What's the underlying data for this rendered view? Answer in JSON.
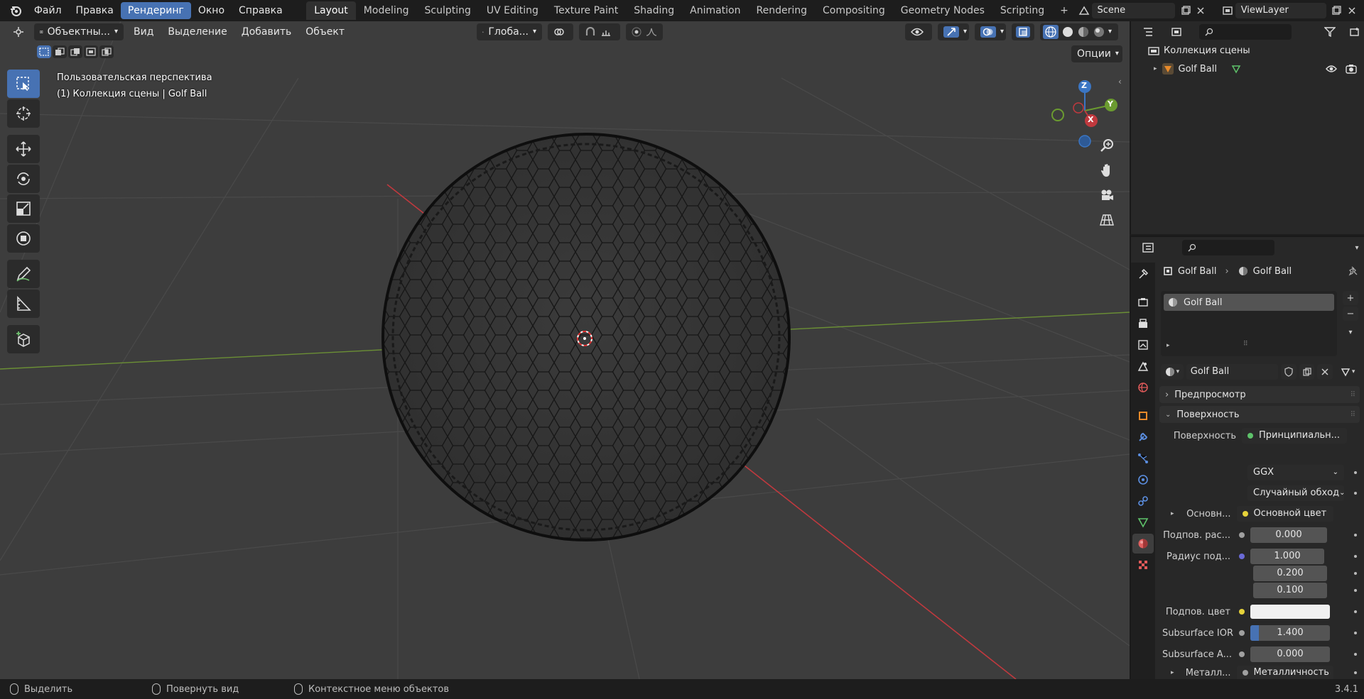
{
  "topbar": {
    "menus": [
      "Файл",
      "Правка",
      "Рендеринг",
      "Окно",
      "Справка"
    ],
    "active_menu": "Рендеринг",
    "workspaces": [
      "Layout",
      "Modeling",
      "Sculpting",
      "UV Editing",
      "Texture Paint",
      "Shading",
      "Animation",
      "Rendering",
      "Compositing",
      "Geometry Nodes",
      "Scripting"
    ],
    "active_workspace": "Layout",
    "add_tab": "+",
    "scene": "Scene",
    "view_layer": "ViewLayer"
  },
  "viewport": {
    "mode": "Объектны...",
    "menus": [
      "Вид",
      "Выделение",
      "Добавить",
      "Объект"
    ],
    "orientation": "Глоба...",
    "options": "Опции",
    "overlay_line1": "Пользовательская перспектива",
    "overlay_line2": "(1) Коллекция сцены | Golf Ball",
    "gizmo": {
      "z": "Z",
      "y": "Y",
      "x": "X"
    }
  },
  "outliner": {
    "collection": "Коллекция сцены",
    "object": "Golf Ball"
  },
  "properties": {
    "breadcrumb_object": "Golf Ball",
    "breadcrumb_material": "Golf Ball",
    "slot": "Golf Ball",
    "material_name": "Golf Ball",
    "panel_preview": "Предпросмотр",
    "panel_surface": "Поверхность",
    "rows": {
      "surface_label": "Поверхность",
      "surface_value": "Принципиальн...",
      "distribution": "GGX",
      "subsurface_method": "Случайный обход",
      "base_label": "Основн...",
      "base_value": "Основной цвет",
      "subsurface_label": "Подпов. рас...",
      "subsurface_value": "0.000",
      "radius_label": "Радиус под...",
      "radius_x": "1.000",
      "radius_y": "0.200",
      "radius_z": "0.100",
      "sub_color_label": "Подпов. цвет",
      "ior_label": "Subsurface IOR",
      "ior_value": "1.400",
      "aniso_label": "Subsurface A...",
      "aniso_value": "0.000",
      "metal_label": "Металл...",
      "metal_value": "Металличность"
    }
  },
  "statusbar": {
    "select": "Выделить",
    "rotate": "Повернуть вид",
    "context": "Контекстное меню объектов",
    "version": "3.4.1"
  },
  "colors": {
    "accent": "#4772b3",
    "x_axis": "#c0393e",
    "y_axis": "#6b9b30",
    "z_axis": "#3b76c4"
  }
}
